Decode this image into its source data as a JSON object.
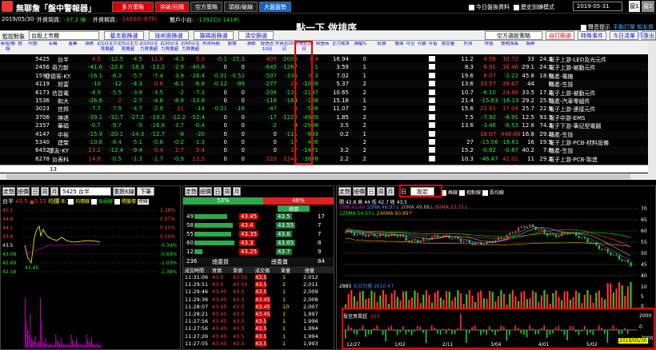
{
  "app": {
    "title": "無聊詹「盤中警報器」",
    "tabs": [
      "多方策略",
      "突破/回檔",
      "空方策略",
      "頭部/破線",
      "大盤盤勢"
    ]
  },
  "topright": {
    "check1": "今日盤後資料",
    "check2": "歷史訓練模式",
    "date": "2019-05-31",
    "win1": "窗1",
    "win2": "窗2"
  },
  "status": {
    "date": "2019/05/30",
    "foreign_label": "外資現貨:",
    "foreign_val": "-37.2 億",
    "futures_label": "外資期貨:",
    "futures_val": "-14330(-876)",
    "retail_label": "散戶小台:",
    "retail_val": "-1392口(-1418)"
  },
  "banner": "點一下 做排序",
  "toolbar": {
    "watch_label": "監控對象",
    "watch_value": "台股上市櫃",
    "buttons": [
      "基本面篩選",
      "技術面篩選",
      "籌碼面篩選",
      "清空篩選"
    ],
    "right": [
      "空方選股策略",
      "自訂篩選",
      "特殊事件",
      "今日清單",
      "匯出"
    ],
    "sound": "聲音提示",
    "manual": "手動訂單",
    "favorites": "股友資訊"
  },
  "grid": {
    "headers": [
      "新增/刪除",
      "燈",
      "代號",
      "名稱",
      "產業",
      "漲跌",
      "近1日主力買賣超",
      "近5日主力買賣超",
      "近10日主力買賣超",
      "近20日主力買賣超",
      "近60日主力買賣超",
      "外資持股",
      "股價",
      "漲跌",
      "投信近10日",
      "外資近10日",
      "外資近20日",
      "自營商",
      "主力成本",
      "漲幅%",
      "低價",
      "雙面",
      "可空",
      "可融",
      "可借",
      "成交量",
      "外資",
      "市值",
      "營收成長",
      "族群"
    ],
    "rows": [
      {
        "id": "5425",
        "name": "台半",
        "v": [
          "4.5",
          "-12.5",
          "-4.5",
          "11.6",
          "-4.3"
        ],
        "f": "5.3",
        "c": "-0.1",
        "i": "-25.3",
        "a": "405",
        "b": "-2005",
        "d": "0.4",
        "e": "16.94",
        "g": "0",
        "k": "11.2",
        "l": "4.56",
        "m": "10.72",
        "n": "33",
        "o": "24.3",
        "grp": "電子上游-LED及光元件",
        "cls": "grn"
      },
      {
        "id": "2456",
        "name": "奇力新",
        "v": [
          "-41.6",
          "-22.6",
          "-18.3",
          "-13.2",
          "-2.9"
        ],
        "f": "-40.8",
        "c": "0",
        "i": "0",
        "a": "-645",
        "b": "-1267",
        "d": "-1",
        "e": "3.59",
        "g": "1",
        "k": "8.3",
        "l": "6.91",
        "m": "16.46",
        "n": "29.1",
        "o": "24.1",
        "grp": "電子上游-被動元件",
        "cls": "red"
      },
      {
        "id": "1590",
        "name": "亞德客-KY",
        "v": [
          "-16.1",
          "-6.3",
          "-5.7",
          "-7.4",
          "-3.9"
        ],
        "f": "-26.4",
        "c": "-0.01",
        "i": "-0.52",
        "a": "-507",
        "b": "-336",
        "d": "-0.3",
        "e": "7.02",
        "g": "1",
        "k": "19.6",
        "l": "8.07",
        "m": "-2.22",
        "n": "45.8",
        "o": "18.9",
        "grp": "傳產-電機",
        "cls": "red"
      },
      {
        "id": "4119",
        "name": "旭富",
        "v": [
          "-10",
          "-12",
          "-4.3",
          "0.6",
          "-6.1"
        ],
        "f": "-6.9",
        "c": "-0.12",
        "i": "-99",
        "a": "-277",
        "b": "20",
        "d": "-1009",
        "e": "5.37",
        "g": "2",
        "k": "13.6",
        "l": "33.57",
        "m": "39.67",
        "n": "44",
        "o": "8",
        "grp": "傳產-生技",
        "cls": "red"
      },
      {
        "id": "6173",
        "name": "信昌電",
        "v": [
          "-4.9",
          "-5.5",
          "-3.9",
          "-3.5",
          "-2"
        ],
        "f": "-7.3",
        "c": "0",
        "i": "0",
        "a": "-206",
        "b": "-221",
        "d": "-2197",
        "e": "10.65",
        "g": "2",
        "k": "10.7",
        "l": "-6.10",
        "m": "24.88",
        "n": "33.5",
        "o": "17.2",
        "grp": "電子上游-被動元件",
        "cls": "red"
      },
      {
        "id": "1536",
        "name": "和大",
        "v": [
          "-26.6",
          "2",
          "-2.7",
          "-4.8",
          "-8.9"
        ],
        "f": "-13.8",
        "c": "0",
        "i": "0",
        "a": "-118",
        "b": "-164",
        "d": "-168",
        "e": "15.18",
        "g": "1",
        "k": "21.4",
        "l": "-15.63",
        "m": "-16.13",
        "n": "29.2",
        "o": "25.5",
        "grp": "傳產-汽車零組件",
        "cls": "red"
      },
      {
        "id": "3023",
        "name": "信邦",
        "v": [
          "-7.7",
          "-7.9",
          "-4.7",
          "-2.9",
          "11"
        ],
        "f": "-14",
        "c": "-0.01",
        "i": "-18",
        "a": "-47",
        "b": "-5",
        "d": "-558",
        "e": "11.07",
        "g": "2",
        "k": "15.6",
        "l": "21.61",
        "m": "17.04",
        "n": "25.7",
        "o": "22.9",
        "grp": "電子上游-連接元件",
        "cls": "red"
      },
      {
        "id": "3706",
        "name": "神達",
        "v": [
          "-39.1",
          "-32.7",
          "-27.2",
          "-19.3",
          "-12.2"
        ],
        "f": "-52.4",
        "c": "0",
        "i": "0",
        "a": "-17",
        "b": "-1222",
        "d": "-4989",
        "e": "1.85",
        "g": "2",
        "k": "7.5",
        "l": "-7.92",
        "m": "-8.91",
        "n": "12.5",
        "o": "93.7",
        "grp": "電子中游-EMS",
        "cls": "red"
      },
      {
        "id": "2357",
        "name": "華碩",
        "v": [
          "-0.7",
          "-9.7",
          "-9",
          "-16.8",
          "-3.7"
        ],
        "f": "-0.4",
        "c": "0",
        "i": "0",
        "a": "-2",
        "b": "-4",
        "d": "-2998",
        "e": "3.5",
        "g": "2",
        "k": "13.6",
        "l": "-3.46",
        "m": "-6.53",
        "n": "12.8",
        "o": "74.3",
        "grp": "電子下游-筆記型電腦",
        "cls": "grn"
      },
      {
        "id": "4147",
        "name": "中裕",
        "v": [
          "-15.9",
          "-20.1",
          "-14.3",
          "-12.7",
          "-8"
        ],
        "f": "-20",
        "c": "0",
        "i": "0",
        "a": "0",
        "b": "-111",
        "d": "-993",
        "e": "0.2",
        "g": "1",
        "k": "",
        "l": "18.07",
        "m": "446.66",
        "n": "16.8",
        "o": "29.2",
        "grp": "傳產-生技",
        "cls": "red"
      },
      {
        "id": "5340",
        "name": "建榮",
        "v": [
          "-10.8",
          "-8.4",
          "-5.1",
          "-0.8",
          "-0.2"
        ],
        "f": "-1.3",
        "c": "0",
        "i": "0",
        "a": "0",
        "b": "-17",
        "d": "-406",
        "e": "",
        "g": "2",
        "k": "27",
        "l": "-15.56",
        "m": "-16.61",
        "n": "16",
        "o": "19.5",
        "grp": "電子上游-PCB-材料設備",
        "cls": "red"
      },
      {
        "id": "6452",
        "name": "康友-KY",
        "v": [
          "23.2",
          "-12.4",
          "-9.4",
          "0.4",
          "2.7"
        ],
        "f": "5.4",
        "c": "0",
        "i": "0",
        "a": "0",
        "b": "17",
        "d": "-1471",
        "e": "3.2",
        "g": "2",
        "k": "15.2",
        "l": "-0.62",
        "m": "-0.87",
        "n": "40.2",
        "o": "7.8",
        "grp": "傳產-生技",
        "cls": "red"
      },
      {
        "id": "6278",
        "name": "台表科",
        "v": [
          "14.8",
          "-0.5",
          "-1.3",
          "-1.7",
          "-0.9"
        ],
        "f": "13.3",
        "c": "0",
        "i": "0",
        "a": "223",
        "b": "1345",
        "d": "-3878",
        "e": "2.2",
        "g": "2",
        "k": "10.3",
        "l": "-46.47",
        "m": "42.01",
        "n": "11",
        "o": "29.2",
        "grp": "電子上游-PCB-製造",
        "cls": "grn"
      }
    ],
    "footer_value": "13"
  },
  "minute": {
    "tabs": [
      "走勢",
      "細價",
      "日",
      "周",
      "月"
    ],
    "stock": "5425 台半",
    "add_btn": "重跌K線",
    "next_btn": "下筆",
    "info_name": "台半",
    "info_price": "43.5",
    "info_chg": "▲0.15",
    "info_vol": "均價",
    "info_detail": "8:10",
    "legend": [
      "均價線",
      "強弱線",
      "開盤價",
      "總線"
    ],
    "yaxis_left": [
      "45.1",
      "44.6",
      "44.1",
      "43.6",
      "43.5",
      "43.08",
      "42.69",
      "42.18"
    ],
    "yaxis_right": [
      "1.38%",
      "0.97%",
      "0.55%",
      "0.14%",
      "-0.34%",
      "-0.69%",
      "-1.03%",
      "-1.38%"
    ],
    "last_price": "43.45"
  },
  "book": {
    "tabs": [
      "走勢",
      "細價",
      "日",
      "周",
      "月"
    ],
    "buy_pct": "53%",
    "sell_pct": "46%",
    "head": "總價",
    "rows": [
      [
        "49",
        "43.45",
        "43.5",
        "17"
      ],
      [
        "58",
        "43.4",
        "43.55",
        "7"
      ],
      [
        "55",
        "43.35",
        "43.6",
        "7"
      ],
      [
        "60",
        "43.3",
        "43.65",
        "8"
      ],
      [
        "12",
        "43.25",
        "43.7",
        "9"
      ]
    ],
    "summary": [
      "236",
      "總委買",
      "總委賣",
      "84"
    ],
    "trade_head": [
      "成交時間",
      "買價",
      "賣價",
      "成交價",
      "單量",
      "總量"
    ],
    "trades": [
      [
        "11:31:06",
        "43.5",
        "43.55",
        "43.5",
        "1",
        "2,012"
      ],
      [
        "11:29:51",
        "43.5",
        "43.55",
        "43.5",
        "2",
        "2,011"
      ],
      [
        "11:29:46",
        "43.45",
        "43.5",
        "43.5",
        "1",
        "2,009"
      ],
      [
        "11:29:36",
        "43.45",
        "43.5",
        "43.45",
        "1",
        "2,008"
      ],
      [
        "11:28:07",
        "43.45",
        "43.5",
        "43.45",
        "10",
        "2,007"
      ],
      [
        "11:28:21",
        "43.45",
        "43.5",
        "43.45",
        "1",
        "1,997"
      ],
      [
        "11:27:56",
        "43.45",
        "43.5",
        "43.5",
        "1",
        "1,996"
      ],
      [
        "11:27:56",
        "43.45",
        "43.5",
        "43.5",
        "1",
        "1,994"
      ],
      [
        "11:27:26",
        "43.45",
        "43.5",
        "43.5",
        "1",
        "1,994"
      ],
      [
        "11:27:05",
        "43.45",
        "43.5",
        "43.5",
        "1",
        "1,993"
      ]
    ]
  },
  "kline": {
    "tabs": [
      "走勢",
      "細價",
      "日",
      "周",
      "月"
    ],
    "select": "日",
    "btn": "設定",
    "check1": "格線",
    "check2": "相對線",
    "check3": "長均線",
    "info": "開 42.8 高 44 低 42.7 收 43.5",
    "ma": [
      "5MA 43.44",
      "10MA 46.97↓",
      "20MA 49.88↓",
      "60MA 53.72↓",
      "120MA 54.07↓",
      "240MA 60.89↑"
    ],
    "vol_label": "2885",
    "vol_ma": "五日均量 2610.4↑",
    "foreign_label": "投信買賣超",
    "foreign_val": "-253",
    "dates": [
      "12/27",
      "1/02",
      "2/11",
      "3/04",
      "4/01",
      "5/02"
    ],
    "date_stamp": "2019/05/30",
    "yaxis": [
      "70",
      "65",
      "60",
      "55",
      "50",
      "45",
      "40"
    ],
    "vol_axis": [
      "10",
      "5",
      "0"
    ],
    "inv_axis": [
      "2000",
      "0",
      "-2000"
    ]
  }
}
